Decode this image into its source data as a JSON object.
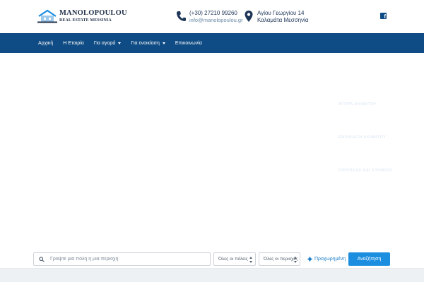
{
  "logo": {
    "name": "MANOLOPOULOU",
    "subtitle": "REAL ESTATE MESSINIA"
  },
  "contact": {
    "phone": "(+30) 27210 99260",
    "email": "info@manolopoulou.gr",
    "address_line1": "Αγίου Γεωργίου 14",
    "address_line2": "Καλαμάτα Μεσσηνία"
  },
  "social": {
    "facebook_icon": "facebook-icon"
  },
  "nav": {
    "items": [
      {
        "label": "Αρχική",
        "dropdown": false
      },
      {
        "label": "Η Εταιρία",
        "dropdown": false
      },
      {
        "label": "Για αγορά",
        "dropdown": true
      },
      {
        "label": "Για ενοικίαση",
        "dropdown": true
      },
      {
        "label": "Επικοινωνία",
        "dropdown": false
      }
    ]
  },
  "hero": {
    "links": [
      "ΑΓΟΡΑ ΑΚΙΝΗΤΟΥ",
      "ΕΝΟΙΚΙΑΣΗ ΑΚΙΝΗΤΟΥ",
      "ΟΙΚΟΠΕΔΑ ΚΑΙ ΚΤΗΜΑΤΑ"
    ]
  },
  "search": {
    "placeholder": "Γράψτε μια πόλη ή μια περιοχή",
    "city_select": "Όλες οι πόλεις",
    "area_select": "Όλες οι περιοχές",
    "advanced_label": "Προχωρημένη",
    "button_label": "Αναζήτηση"
  },
  "colors": {
    "nav_bg": "#0f4b84",
    "accent": "#1c8ee0",
    "text_dark": "#1d3557"
  }
}
